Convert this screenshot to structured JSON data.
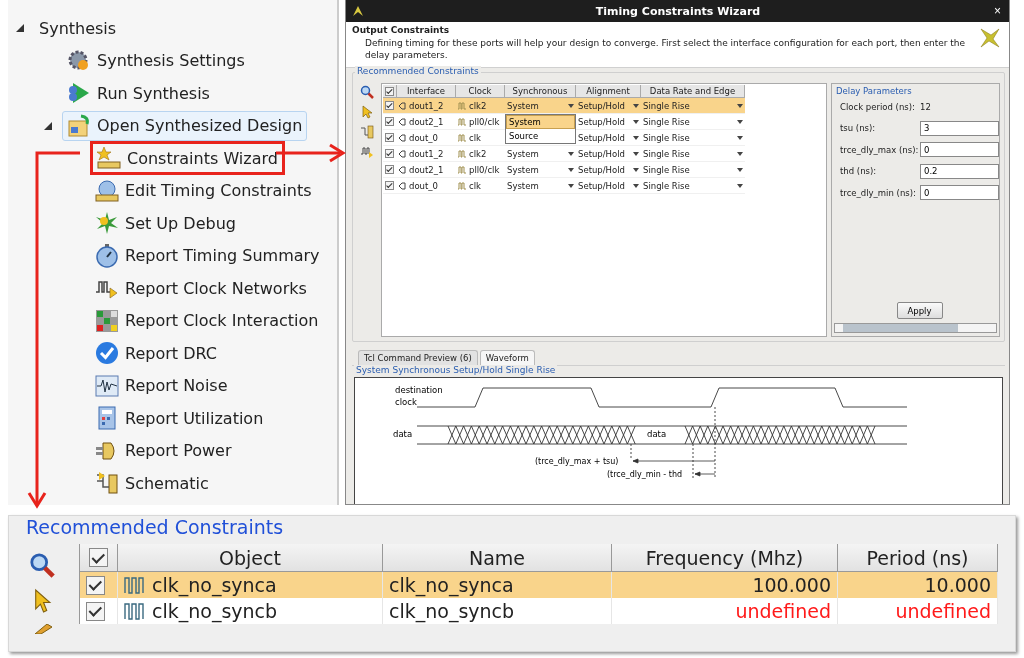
{
  "tree": {
    "label": "Synthesis",
    "expanded": true,
    "children": [
      {
        "label": "Synthesis Settings"
      },
      {
        "label": "Run Synthesis"
      },
      {
        "label": "Open Synthesized Design",
        "expanded": true,
        "selected": true,
        "children": [
          {
            "label": "Constraints Wizard",
            "highlighted": true
          },
          {
            "label": "Edit Timing Constraints"
          },
          {
            "label": "Set Up Debug"
          },
          {
            "label": "Report Timing Summary"
          },
          {
            "label": "Report Clock Networks"
          },
          {
            "label": "Report Clock Interaction"
          },
          {
            "label": "Report DRC"
          },
          {
            "label": "Report Noise"
          },
          {
            "label": "Report Utilization"
          },
          {
            "label": "Report Power"
          },
          {
            "label": "Schematic"
          }
        ]
      }
    ]
  },
  "wizard": {
    "title": "Timing Constraints Wizard",
    "close": "×",
    "heading": "Output Constraints",
    "description": "Defining timing for these ports will help your design to converge. First select the interface configuration for each port, then enter the delay parameters.",
    "group_title": "Recommended Constraints",
    "columns": [
      "Interface",
      "Clock",
      "Synchronous",
      "Alignment",
      "Data Rate and Edge"
    ],
    "header_checked": true,
    "rows": [
      {
        "checked": true,
        "interface": "dout1_2",
        "clock": "clk2",
        "synchronous": "System",
        "alignment": "Setup/Hold",
        "data_rate": "Single Rise",
        "selected": true
      },
      {
        "checked": true,
        "interface": "dout2_1",
        "clock": "pll0/clk",
        "alignment": "Setup/Hold",
        "data_rate": "Single Rise",
        "selected": false
      },
      {
        "checked": true,
        "interface": "dout_0",
        "clock": "clk",
        "alignment": "Setup/Hold",
        "data_rate": "Single Rise",
        "selected": false
      },
      {
        "checked": true,
        "interface": "dout1_2",
        "clock": "clk2",
        "synchronous": "System",
        "alignment": "Setup/Hold",
        "data_rate": "Single Rise",
        "selected": false
      },
      {
        "checked": true,
        "interface": "dout2_1",
        "clock": "pll0/clk",
        "synchronous": "System",
        "alignment": "Setup/Hold",
        "data_rate": "Single Rise",
        "selected": false
      },
      {
        "checked": true,
        "interface": "dout_0",
        "clock": "clk",
        "synchronous": "System",
        "alignment": "Setup/Hold",
        "data_rate": "Single Rise",
        "selected": false
      }
    ],
    "dropdown": {
      "options": [
        {
          "label": "System",
          "selected": true
        },
        {
          "label": "Source",
          "selected": false
        }
      ]
    },
    "delay_parameters": {
      "title": "Delay Parameters",
      "fields": [
        {
          "kind": "text",
          "label": "Clock period (ns):",
          "value": "12"
        },
        {
          "kind": "input",
          "label": "tsu (ns):",
          "value": "3"
        },
        {
          "kind": "input",
          "label": "trce_dly_max (ns):",
          "value": "0"
        },
        {
          "kind": "input",
          "label": "thd (ns):",
          "value": "0.2"
        },
        {
          "kind": "input",
          "label": "trce_dly_min (ns):",
          "value": "0"
        }
      ],
      "apply": "Apply"
    },
    "tabs": [
      {
        "label": "Tcl Command Preview (6)",
        "selected": false
      },
      {
        "label": "Waveform",
        "selected": true
      }
    ],
    "waveform": {
      "title": "System Synchronous Setup/Hold Single Rise",
      "clock_label": [
        "destination",
        "clock"
      ],
      "data_label": "data",
      "window_label": "data",
      "measurements": [
        "(trce_dly_max + tsu)",
        "(trce_dly_min - thd"
      ]
    }
  },
  "clock_constraints": {
    "title": "Recommended Constraints",
    "header_checked": true,
    "columns": [
      "Object",
      "Name",
      "Frequency (Mhz)",
      "Period (ns)"
    ],
    "rows": [
      {
        "checked": true,
        "object": "clk_no_synca",
        "name": "clk_no_synca",
        "frequency": "100.000",
        "period": "10.000",
        "undefined": false,
        "selected": true
      },
      {
        "checked": true,
        "object": "clk_no_syncb",
        "name": "clk_no_syncb",
        "frequency": "undefined",
        "period": "undefined",
        "undefined": true,
        "selected": false
      }
    ]
  }
}
